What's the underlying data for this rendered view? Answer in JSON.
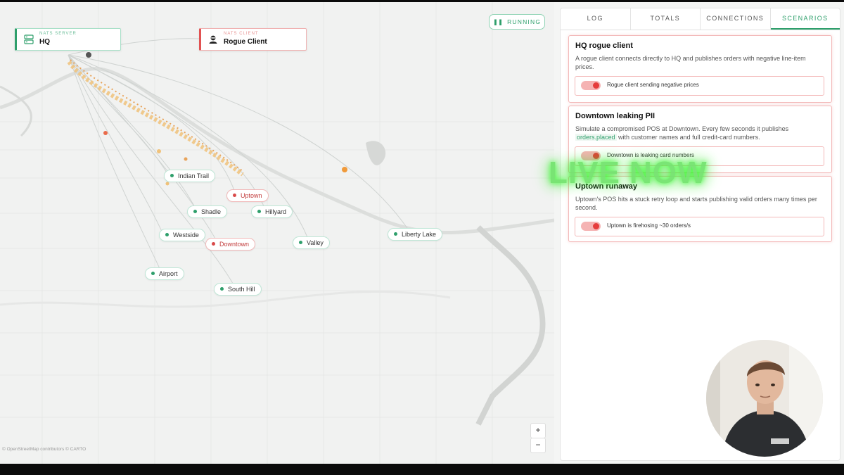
{
  "map": {
    "server_card": {
      "kind": "NATS SERVER",
      "title": "HQ"
    },
    "client_card": {
      "kind": "NATS CLIENT",
      "title": "Rogue Client"
    },
    "status": {
      "label": "RUNNING"
    },
    "nodes": [
      {
        "name": "Indian Trail",
        "state": "ok"
      },
      {
        "name": "Uptown",
        "state": "bad"
      },
      {
        "name": "Shadle",
        "state": "ok"
      },
      {
        "name": "Hillyard",
        "state": "ok"
      },
      {
        "name": "Westside",
        "state": "ok"
      },
      {
        "name": "Downtown",
        "state": "bad"
      },
      {
        "name": "Valley",
        "state": "ok"
      },
      {
        "name": "Liberty Lake",
        "state": "ok"
      },
      {
        "name": "Airport",
        "state": "ok"
      },
      {
        "name": "South Hill",
        "state": "ok"
      }
    ],
    "zoom_in": "+",
    "zoom_out": "−",
    "attribution": "© OpenStreetMap contributors © CARTO"
  },
  "panel": {
    "tabs": [
      "LOG",
      "TOTALS",
      "CONNECTIONS",
      "SCENARIOS"
    ],
    "active_tab": "SCENARIOS",
    "scenarios": [
      {
        "title": "HQ rogue client",
        "description": "A rogue client connects directly to HQ and publishes orders with negative line-item prices.",
        "toggle_label": "Rogue client sending negative prices",
        "enabled": true
      },
      {
        "title": "Downtown leaking PII",
        "description_pre": "Simulate a compromised POS at Downtown. Every few seconds it publishes ",
        "description_code": "orders.placed",
        "description_post": " with customer names and full credit-card numbers.",
        "toggle_label": "Downtown is leaking card numbers",
        "enabled": true
      },
      {
        "title": "Uptown runaway",
        "description": "Uptown's POS hits a stuck retry loop and starts publishing valid orders many times per second.",
        "toggle_label": "Uptown is firehosing ~30 orders/s",
        "enabled": true
      }
    ]
  },
  "overlay": {
    "live_text": "LIVE NOW"
  },
  "colors": {
    "accent": "#2e9f6b",
    "alert": "#e15252",
    "live_glow": "#39ff30"
  }
}
